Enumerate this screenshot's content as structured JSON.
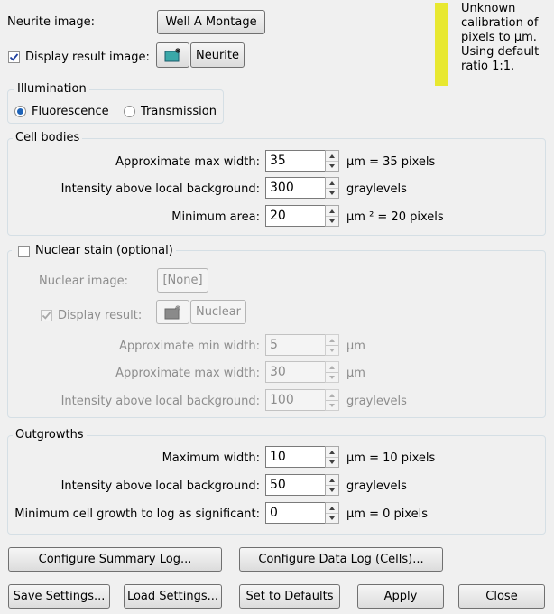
{
  "neurite": {
    "image_label": "Neurite image:",
    "image_button": "Well A Montage",
    "display_result_label": "Display result image:",
    "display_result_checked": true,
    "result_button": "Neurite"
  },
  "notice": {
    "color": "#e8e830",
    "lines": [
      "Unknown",
      "calibration of",
      "pixels to µm.",
      "Using default",
      "ratio 1:1."
    ]
  },
  "illumination": {
    "title": "Illumination",
    "options": [
      "Fluorescence",
      "Transmission"
    ],
    "selected": "Fluorescence"
  },
  "cell_bodies": {
    "title": "Cell bodies",
    "fields": [
      {
        "label": "Approximate max width:",
        "value": "35",
        "unit": "µm = 35 pixels"
      },
      {
        "label": "Intensity above local background:",
        "value": "300",
        "unit": "graylevels"
      },
      {
        "label": "Minimum area:",
        "value": "20",
        "unit": "µm ² = 20 pixels"
      }
    ]
  },
  "nuclear": {
    "title": "Nuclear stain (optional)",
    "checked": false,
    "image_label": "Nuclear image:",
    "image_button": "[None]",
    "display_result_label": "Display result:",
    "result_button": "Nuclear",
    "fields": [
      {
        "label": "Approximate min width:",
        "value": "5",
        "unit": "µm"
      },
      {
        "label": "Approximate max width:",
        "value": "30",
        "unit": "µm"
      },
      {
        "label": "Intensity above local background:",
        "value": "100",
        "unit": "graylevels"
      }
    ]
  },
  "outgrowths": {
    "title": "Outgrowths",
    "fields": [
      {
        "label": "Maximum width:",
        "value": "10",
        "unit": "µm = 10 pixels"
      },
      {
        "label": "Intensity above local background:",
        "value": "50",
        "unit": "graylevels"
      },
      {
        "label": "Minimum cell growth to log as significant:",
        "value": "0",
        "unit": "µm = 0 pixels"
      }
    ]
  },
  "buttons": {
    "configure_summary": "Configure Summary Log...",
    "configure_data": "Configure Data Log (Cells)...",
    "save": "Save Settings...",
    "load": "Load Settings...",
    "defaults": "Set to Defaults",
    "apply": "Apply",
    "close": "Close"
  }
}
